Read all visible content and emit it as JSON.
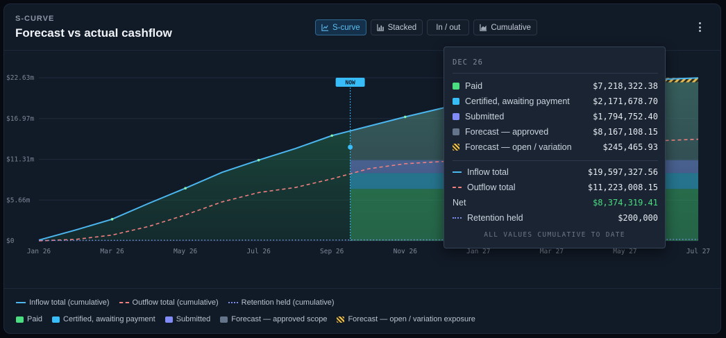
{
  "header": {
    "eyebrow": "S-CURVE",
    "title": "Forecast vs actual cashflow",
    "tabs": [
      {
        "label": "S-curve",
        "icon": "line-chart-icon",
        "active": true
      },
      {
        "label": "Stacked",
        "icon": "bar-chart-icon",
        "active": false
      },
      {
        "label": "In / out",
        "icon": "",
        "active": false
      },
      {
        "label": "Cumulative",
        "icon": "area-chart-icon",
        "active": false
      }
    ],
    "menu_icon": "more-vertical-icon"
  },
  "colors": {
    "paid": "#4ade80",
    "certified": "#38bdf8",
    "submitted": "#818cf8",
    "forecast_approved": "#64748b",
    "forecast_open": "#f6c453",
    "inflow": "#4cb6ef",
    "outflow": "#f08080",
    "retention": "#7c8ff0"
  },
  "chart_data": {
    "type": "area",
    "x_ticks": [
      "Jan 26",
      "Mar 26",
      "May 26",
      "Jul 26",
      "Sep 26",
      "Nov 26",
      "Jan 27",
      "Mar 27",
      "May 27",
      "Jul 27"
    ],
    "y_ticks": [
      "$0",
      "$5.66m",
      "$11.31m",
      "$16.97m",
      "$22.63m"
    ],
    "ylim": [
      0,
      22.63
    ],
    "y_unit": "$m",
    "now_label": "NOW",
    "now_month": 8.5,
    "series": [
      {
        "name": "Inflow total (cumulative)",
        "style": "line",
        "x_month": [
          0,
          1,
          2,
          3,
          4,
          5,
          6,
          7,
          8,
          9,
          10,
          11,
          12,
          13,
          14,
          15,
          16,
          17,
          18
        ],
        "values": [
          0.1,
          1.5,
          3.0,
          5.2,
          7.3,
          9.5,
          11.2,
          12.8,
          14.6,
          15.9,
          17.2,
          18.4,
          19.6,
          20.6,
          21.3,
          21.8,
          22.1,
          22.4,
          22.6
        ]
      },
      {
        "name": "Outflow total (cumulative)",
        "style": "dashed",
        "x_month": [
          0,
          1,
          2,
          3,
          4,
          5,
          6,
          7,
          8,
          9,
          10,
          11,
          12,
          13,
          14,
          15,
          16,
          17,
          18
        ],
        "values": [
          0,
          0.2,
          0.8,
          2.0,
          3.6,
          5.4,
          6.7,
          7.4,
          8.6,
          10.0,
          10.7,
          11.0,
          11.2,
          11.4,
          12.0,
          12.6,
          13.2,
          13.9,
          14.1
        ]
      },
      {
        "name": "Retention held (cumulative)",
        "style": "dotted",
        "x_month": [
          0,
          18
        ],
        "values": [
          0.05,
          0.2
        ]
      }
    ],
    "stack_bands": [
      {
        "name": "Paid",
        "from_month": 7,
        "to_month": 18,
        "y0": 0,
        "y1": 7.2
      },
      {
        "name": "Certified, awaiting payment",
        "from_month": 7,
        "to_month": 18,
        "y0": 7.2,
        "y1": 9.4
      },
      {
        "name": "Submitted",
        "from_month": 7,
        "to_month": 18,
        "y0": 9.4,
        "y1": 11.2
      },
      {
        "name": "Forecast — approved scope",
        "from_month": 7,
        "to_month": 18,
        "y0": 11.2,
        "y1": 22.4
      },
      {
        "name": "Forecast — open / variation exposure",
        "from_month": 17,
        "to_month": 18,
        "y0": 22.0,
        "y1": 22.6
      }
    ],
    "legend": {
      "lines": [
        {
          "label": "Inflow total (cumulative)",
          "style": "solid",
          "color": "#4cb6ef"
        },
        {
          "label": "Outflow total (cumulative)",
          "style": "dashed",
          "color": "#f08080"
        },
        {
          "label": "Retention held (cumulative)",
          "style": "dotted",
          "color": "#7c8ff0"
        }
      ],
      "areas": [
        {
          "label": "Paid",
          "color": "#4ade80"
        },
        {
          "label": "Certified, awaiting payment",
          "color": "#38bdf8"
        },
        {
          "label": "Submitted",
          "color": "#818cf8"
        },
        {
          "label": "Forecast — approved scope",
          "color": "#64748b"
        },
        {
          "label": "Forecast — open / variation exposure",
          "color": "#f6c453",
          "hatched": true
        }
      ]
    }
  },
  "tooltip": {
    "date": "DEC 26",
    "rows": [
      {
        "label": "Paid",
        "value": "$7,218,322.38",
        "swatch": "#4ade80"
      },
      {
        "label": "Certified, awaiting payment",
        "value": "$2,171,678.70",
        "swatch": "#38bdf8"
      },
      {
        "label": "Submitted",
        "value": "$1,794,752.40",
        "swatch": "#818cf8"
      },
      {
        "label": "Forecast — approved",
        "value": "$8,167,108.15",
        "swatch": "#64748b"
      },
      {
        "label": "Forecast — open / variation",
        "value": "$245,465.93",
        "swatch": "hatch"
      }
    ],
    "totals": [
      {
        "label": "Inflow total",
        "value": "$19,597,327.56",
        "line": "solid",
        "color": "#4cb6ef"
      },
      {
        "label": "Outflow total",
        "value": "$11,223,008.15",
        "line": "dashed",
        "color": "#f08080"
      },
      {
        "label": "Net",
        "value": "$8,374,319.41",
        "line": "none",
        "positive": true
      },
      {
        "label": "Retention held",
        "value": "$200,000",
        "line": "dotted",
        "color": "#7c8ff0"
      }
    ],
    "footer": "ALL VALUES CUMULATIVE TO DATE"
  }
}
